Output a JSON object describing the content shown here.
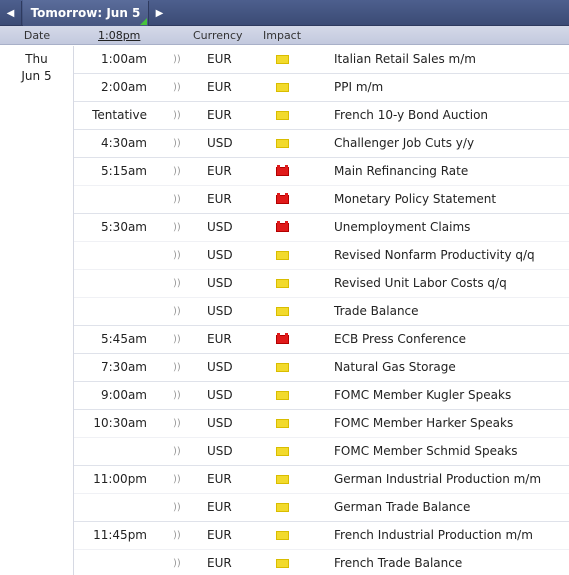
{
  "topbar": {
    "prev_icon": "chevron-left-icon",
    "day_label": "Tomorrow: Jun 5",
    "next_icon": "chevron-right-icon"
  },
  "columns": {
    "date": "Date",
    "time": "1:08pm",
    "currency": "Currency",
    "impact": "Impact"
  },
  "date": {
    "weekday": "Thu",
    "day": "Jun 5"
  },
  "colors": {
    "low_impact": "#f2da2c",
    "high_impact": "#e01a1a",
    "header_bg": "#3b4b75"
  },
  "events": [
    {
      "time": "1:00am",
      "currency": "EUR",
      "impact": "low",
      "event": "Italian Retail Sales m/m"
    },
    {
      "time": "2:00am",
      "currency": "EUR",
      "impact": "low",
      "event": "PPI m/m"
    },
    {
      "time": "Tentative",
      "currency": "EUR",
      "impact": "low",
      "event": "French 10-y Bond Auction"
    },
    {
      "time": "4:30am",
      "currency": "USD",
      "impact": "low",
      "event": "Challenger Job Cuts y/y"
    },
    {
      "time": "5:15am",
      "currency": "EUR",
      "impact": "high",
      "event": "Main Refinancing Rate"
    },
    {
      "time": "",
      "currency": "EUR",
      "impact": "high",
      "event": "Monetary Policy Statement"
    },
    {
      "time": "5:30am",
      "currency": "USD",
      "impact": "high",
      "event": "Unemployment Claims"
    },
    {
      "time": "",
      "currency": "USD",
      "impact": "low",
      "event": "Revised Nonfarm Productivity q/q"
    },
    {
      "time": "",
      "currency": "USD",
      "impact": "low",
      "event": "Revised Unit Labor Costs q/q"
    },
    {
      "time": "",
      "currency": "USD",
      "impact": "low",
      "event": "Trade Balance"
    },
    {
      "time": "5:45am",
      "currency": "EUR",
      "impact": "high",
      "event": "ECB Press Conference"
    },
    {
      "time": "7:30am",
      "currency": "USD",
      "impact": "low",
      "event": "Natural Gas Storage"
    },
    {
      "time": "9:00am",
      "currency": "USD",
      "impact": "low",
      "event": "FOMC Member Kugler Speaks"
    },
    {
      "time": "10:30am",
      "currency": "USD",
      "impact": "low",
      "event": "FOMC Member Harker Speaks"
    },
    {
      "time": "",
      "currency": "USD",
      "impact": "low",
      "event": "FOMC Member Schmid Speaks"
    },
    {
      "time": "11:00pm",
      "currency": "EUR",
      "impact": "low",
      "event": "German Industrial Production m/m"
    },
    {
      "time": "",
      "currency": "EUR",
      "impact": "low",
      "event": "German Trade Balance"
    },
    {
      "time": "11:45pm",
      "currency": "EUR",
      "impact": "low",
      "event": "French Industrial Production m/m"
    },
    {
      "time": "",
      "currency": "EUR",
      "impact": "low",
      "event": "French Trade Balance"
    }
  ]
}
